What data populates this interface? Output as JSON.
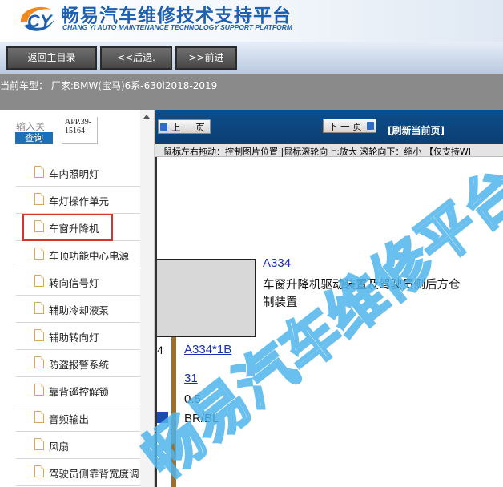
{
  "header": {
    "title": "畅易汽车维修技术支持平台",
    "subtitle": "CHANG YI AUTO MAINTENANCE TECHNOLOGY SUPPORT PLATFORM",
    "logo_icon": "cy-logo-icon"
  },
  "nav": {
    "home_label": "返回主目录",
    "back_label": "<<后退.",
    "forward_label": ">>前进"
  },
  "model": {
    "text": "当前车型：  厂家:BMW(宝马)6系-630i2018-2019"
  },
  "sidebar": {
    "search_label": "输入关",
    "search_button": "查询",
    "search_value": "APP.39-15164",
    "items": [
      {
        "label": "车内照明灯"
      },
      {
        "label": "车灯操作单元"
      },
      {
        "label": "车窗升降机",
        "selected": true
      },
      {
        "label": "车顶功能中心电源"
      },
      {
        "label": "转向信号灯"
      },
      {
        "label": "辅助冷却液泵"
      },
      {
        "label": "辅助转向灯"
      },
      {
        "label": "防盗报警系统"
      },
      {
        "label": "靠背遥控解锁"
      },
      {
        "label": "音频输出"
      },
      {
        "label": "风扇"
      },
      {
        "label": "驾驶员侧靠背宽度调"
      }
    ]
  },
  "viewer": {
    "prev_label": "上 一 页",
    "next_label": "下 一 页",
    "refresh_label": "[刷新当前页]",
    "tip": "鼠标左右拖动：控制图片位置 |鼠标滚轮向上:放大  滚轮向下：缩小 【仅支持WI",
    "diagram": {
      "component_code": "A334",
      "component_desc_line1": "车窗升降机驱动装置及驾驶员侧后方仓",
      "component_desc_line2": "制装置",
      "pin": "4",
      "connector": "A334*1B",
      "pin_no": "31",
      "wire_size": "0.5",
      "wire_color": "BR/BL"
    }
  },
  "watermark": "畅易汽车维修平台",
  "colors": {
    "brand_blue": "#1d5fb0",
    "toolbar_blue": "#0e4e8a",
    "selection_red": "#d9322b",
    "link_blue": "#1a2fb0"
  }
}
